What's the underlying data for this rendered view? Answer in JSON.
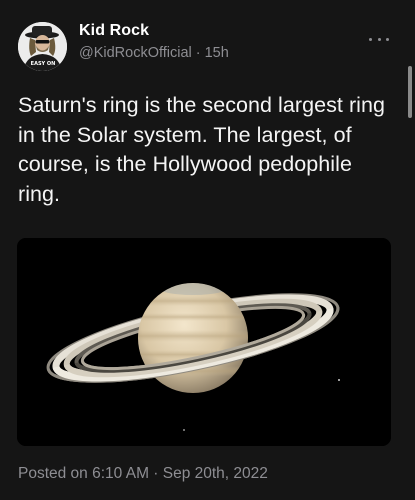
{
  "tweet": {
    "author_name": "Kid Rock",
    "handle": "@KidRockOfficial",
    "separator": "·",
    "age": "15h",
    "body": "Saturn's ring is the second largest ring in the Solar system. The largest, of course, is the Hollywood pedophile ring.",
    "posted_on": "Posted on 6:10 AM · Sep 20th, 2022",
    "avatar_shirt_text": "EASY ON",
    "media_subject": "Saturn",
    "more_icon": "more-horizontal-icon"
  },
  "colors": {
    "background": "#151515",
    "primary_text": "#f5f5f5",
    "secondary_text": "#8e8e93",
    "media_background": "#000000"
  }
}
